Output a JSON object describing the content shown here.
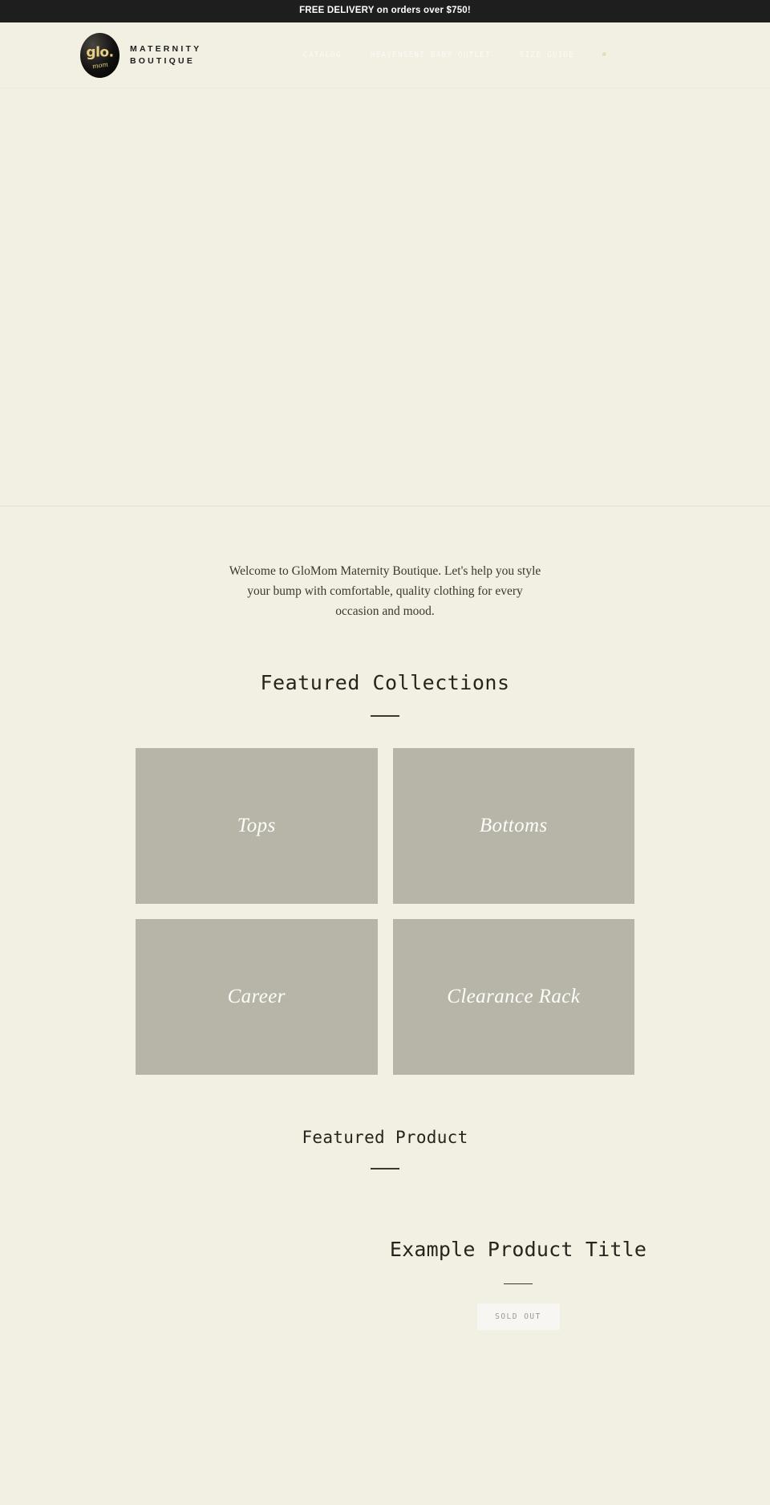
{
  "announcement": {
    "text": "FREE DELIVERY on orders over $750!"
  },
  "header": {
    "logo": {
      "mark_primary": "glo.",
      "mark_script": "mom",
      "word_line1": "MATERNITY",
      "word_line2": "BOUTIQUE"
    },
    "nav": [
      {
        "label": "CATALOG"
      },
      {
        "label": "HEAVENSENT BABY OUTLET"
      },
      {
        "label": "SIZE GUIDE"
      }
    ],
    "search_icon_glyph": "⌕"
  },
  "intro": {
    "text": "Welcome to GloMom Maternity Boutique. Let's help you style your bump with comfortable, quality clothing for every occasion and mood."
  },
  "featured_collections": {
    "heading": "Featured Collections",
    "cards": [
      {
        "label": "Tops"
      },
      {
        "label": "Bottoms"
      },
      {
        "label": "Career"
      },
      {
        "label": "Clearance Rack"
      }
    ]
  },
  "featured_product": {
    "heading": "Featured Product",
    "name": "Example Product Title",
    "button_label": "SOLD OUT"
  },
  "colors": {
    "page_background": "#f2efe3",
    "announcement_background": "#1e1e1e",
    "card_placeholder": "#b7b5a8",
    "accent_gold": "#e9cf84",
    "text_dark": "#26241d"
  }
}
